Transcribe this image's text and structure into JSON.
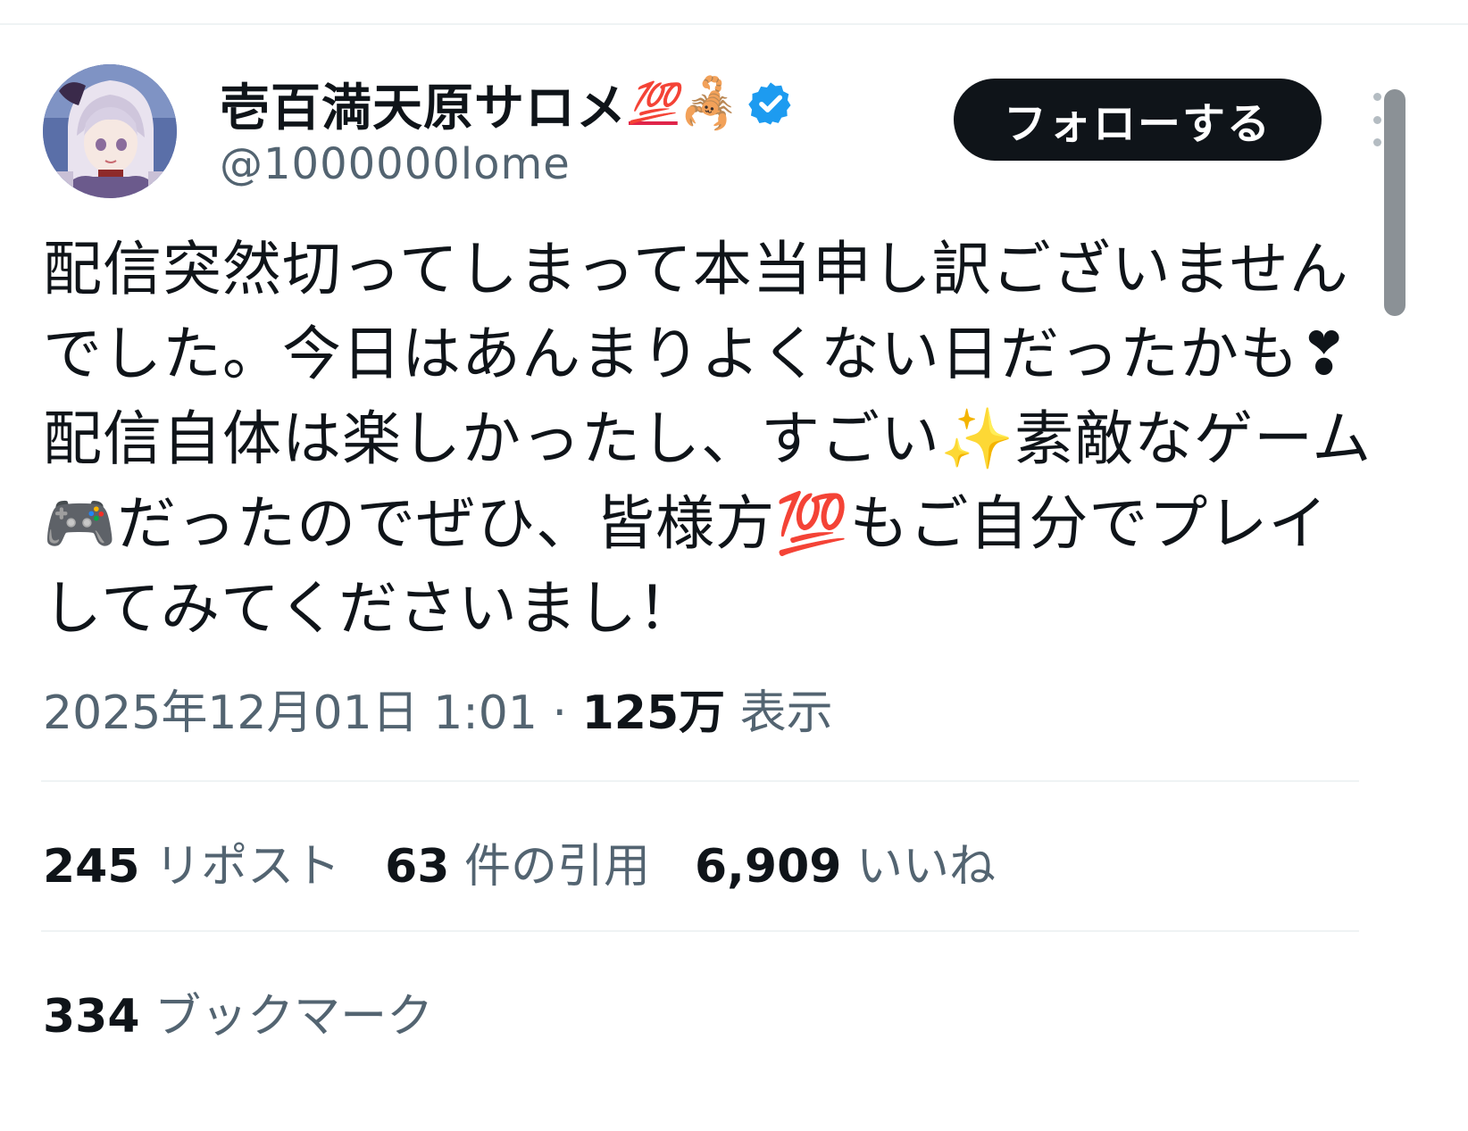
{
  "author": {
    "display_name": "壱百満天原サロメ",
    "name_emoji_1": "💯",
    "name_emoji_2": "🦂",
    "handle": "@1000000lome",
    "verified_icon": "verified-badge-icon",
    "avatar_icon": "avatar"
  },
  "actions": {
    "follow_label": "フォローする",
    "more_icon": "more-vertical-icon"
  },
  "tweet": {
    "text": "配信突然切ってしまって本当申し訳ございませんでした。今日はあんまりよくない日だったかも❣配信自体は楽しかったし、すごい✨素敵なゲーム🎮だったのでぜひ、皆様方💯もご自分でプレイしてみてくださいまし！"
  },
  "meta": {
    "timestamp": "2025年12月01日 1:01",
    "separator": " · ",
    "views_count": "125万",
    "views_label": " 表示"
  },
  "stats": {
    "reposts": {
      "count": "245",
      "label": " リポスト"
    },
    "quotes": {
      "count": "63",
      "label": " 件の引用"
    },
    "likes": {
      "count": "6,909",
      "label": " いいね"
    },
    "bookmarks": {
      "count": "334",
      "label": " ブックマーク"
    }
  },
  "colors": {
    "text_primary": "#0f1419",
    "text_secondary": "#536471",
    "follow_bg": "#0f1419",
    "verified_blue": "#1d9bf0",
    "divider": "#eff3f4"
  }
}
